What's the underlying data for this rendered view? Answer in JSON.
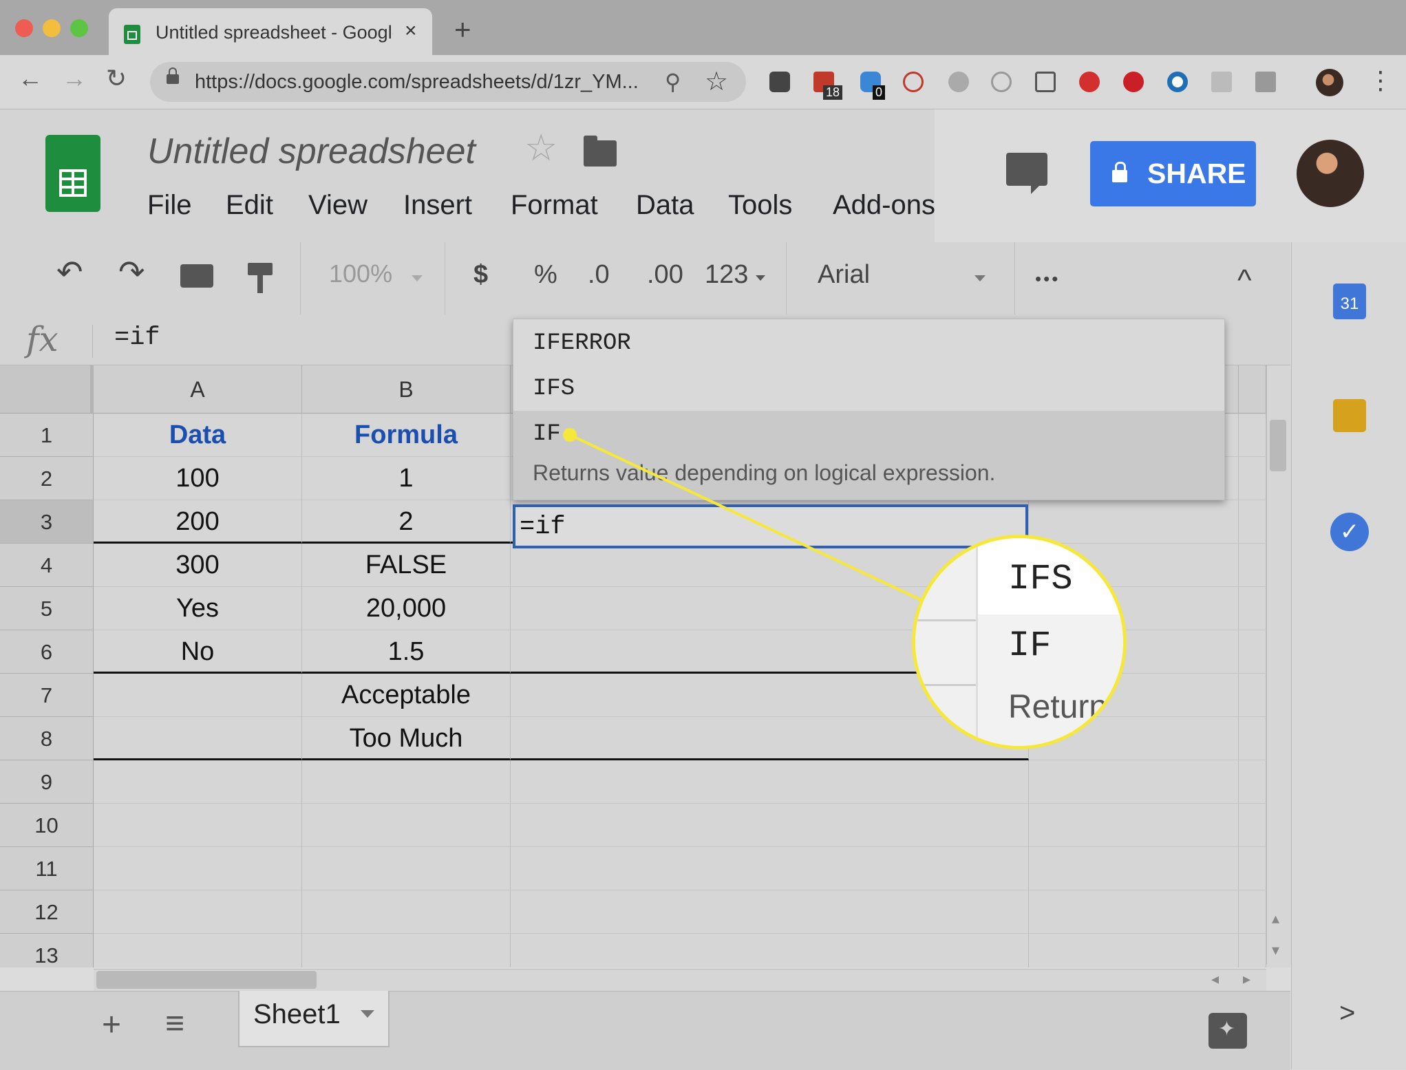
{
  "browser": {
    "tab_title": "Untitled spreadsheet - Google Sheets",
    "tab_close": "×",
    "new_tab": "+",
    "url": "https://docs.google.com/spreadsheets/d/1zr_YM...",
    "badges": {
      "calendar_ext": "18",
      "ghost_ext": "0"
    },
    "nav": {
      "back": "←",
      "forward": "→",
      "reload": "↻",
      "zoom": "⚲",
      "star": "☆",
      "more": "⋮"
    }
  },
  "app": {
    "doc_title": "Untitled spreadsheet",
    "menu": [
      "File",
      "Edit",
      "View",
      "Insert",
      "Format",
      "Data",
      "Tools",
      "Add-ons"
    ],
    "share_label": "SHARE",
    "accent_color": "#3b78e7",
    "sheets_green": "#1e8e3e"
  },
  "toolbar": {
    "undo": "↶",
    "redo": "↷",
    "zoom": "100%",
    "currency": "$",
    "percent": "%",
    "decrease_decimal": ".0",
    "increase_decimal": ".00",
    "more_formats": "123",
    "font": "Arial",
    "more": "•••",
    "collapse": "^"
  },
  "formula_bar": {
    "fx": "fx",
    "value": "=if"
  },
  "grid": {
    "columns": [
      "A",
      "B"
    ],
    "rows": [
      {
        "n": "1",
        "a": "Data",
        "b": "Formula"
      },
      {
        "n": "2",
        "a": "100",
        "b": "1"
      },
      {
        "n": "3",
        "a": "200",
        "b": "2"
      },
      {
        "n": "4",
        "a": "300",
        "b": "FALSE"
      },
      {
        "n": "5",
        "a": "Yes",
        "b": "20,000"
      },
      {
        "n": "6",
        "a": "No",
        "b": "1.5"
      },
      {
        "n": "7",
        "a": "",
        "b": "Acceptable"
      },
      {
        "n": "8",
        "a": "",
        "b": "Too Much"
      },
      {
        "n": "9",
        "a": "",
        "b": ""
      },
      {
        "n": "10",
        "a": "",
        "b": ""
      },
      {
        "n": "11",
        "a": "",
        "b": ""
      },
      {
        "n": "12",
        "a": "",
        "b": ""
      },
      {
        "n": "13",
        "a": "",
        "b": ""
      }
    ],
    "active_cell_value": "=if"
  },
  "autocomplete": {
    "suggestions": [
      "IFERROR",
      "IFS",
      "IF"
    ],
    "selected_description": "Returns value depending on logical expression."
  },
  "magnifier": {
    "line1": "IFS",
    "line2": "IF",
    "line3": "Return"
  },
  "sheets": {
    "active": "Sheet1",
    "add": "+",
    "list": "≡"
  },
  "side_panel": {
    "calendar_day": "31",
    "expand": ">"
  },
  "scroll": {
    "left": "◂",
    "right": "▸",
    "up": "▴",
    "down": "▾"
  }
}
